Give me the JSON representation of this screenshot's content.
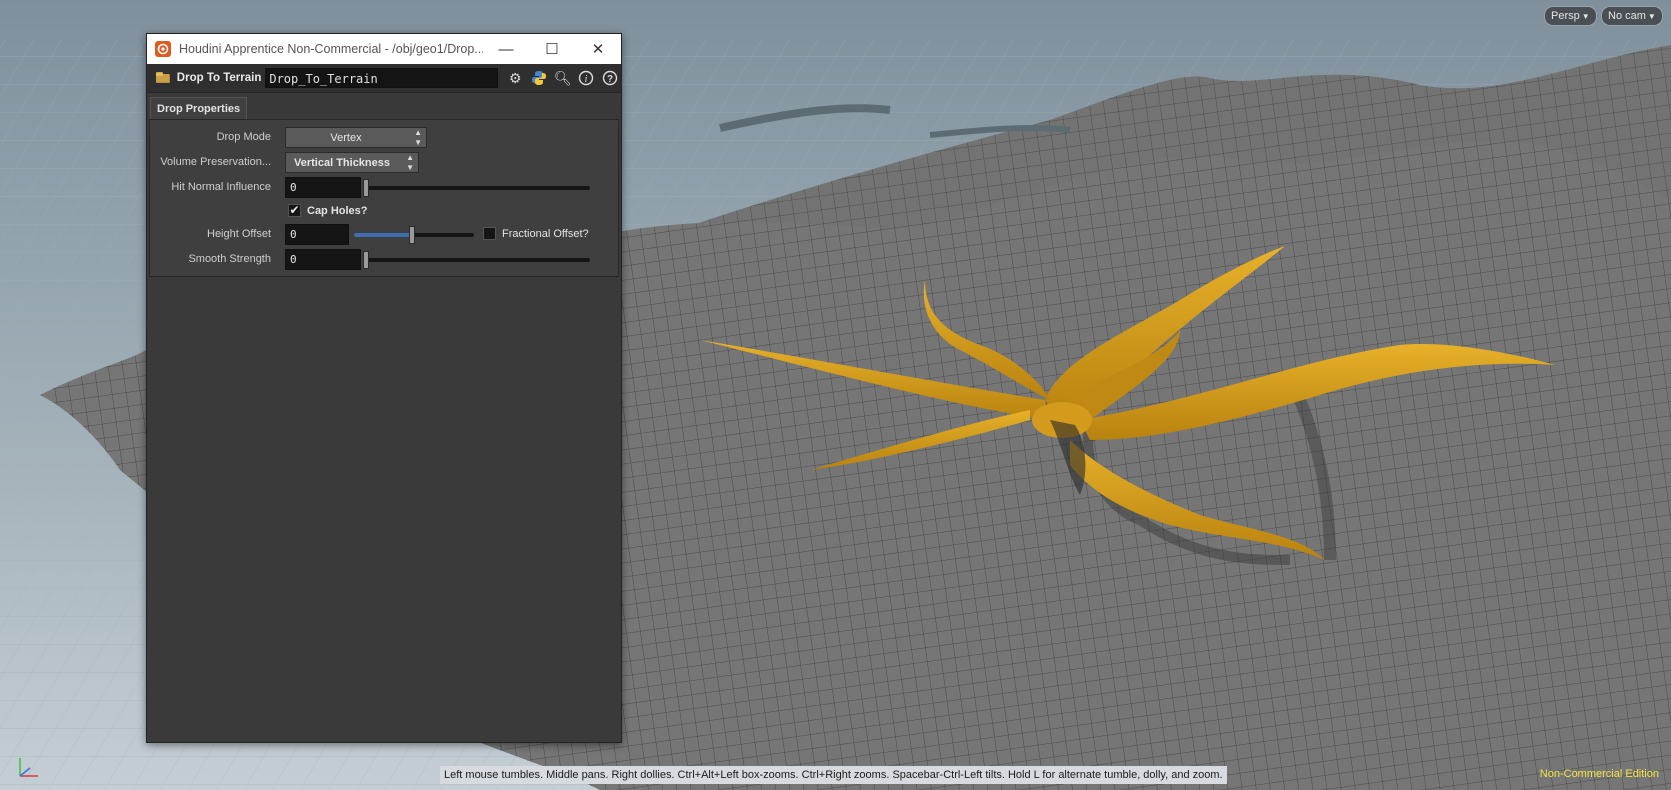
{
  "viewport": {
    "persp_label": "Persp",
    "camera_label": "No cam",
    "status_message": "Left mouse tumbles. Middle pans. Right dollies. Ctrl+Alt+Left box-zooms. Ctrl+Right zooms. Spacebar-Ctrl-Left tilts. Hold L for alternate tumble, dolly, and zoom.",
    "edition": "Non-Commercial Edition",
    "colors": {
      "terrain": "#6e6e6e",
      "object": "#d8a020",
      "sky": "#8fa0ab",
      "edition_text": "#f5e642"
    }
  },
  "dialog": {
    "title": "Houdini Apprentice Non-Commercial - /obj/geo1/Drop...",
    "node_type": "Drop To Terrain",
    "node_name": "Drop_To_Terrain",
    "tab": "Drop Properties",
    "params": {
      "drop_mode": {
        "label": "Drop Mode",
        "value": "Vertex"
      },
      "volume_preservation": {
        "label": "Volume Preservation...",
        "value": "Vertical Thickness"
      },
      "hit_normal_influence": {
        "label": "Hit Normal Influence",
        "value": "0",
        "level": 0
      },
      "cap_holes": {
        "label": "Cap Holes?",
        "checked": true
      },
      "height_offset": {
        "label": "Height Offset",
        "value": "0",
        "level": 0.5
      },
      "fractional_offset": {
        "label": "Fractional Offset?",
        "checked": false
      },
      "smooth_strength": {
        "label": "Smooth Strength",
        "value": "0",
        "level": 0
      }
    }
  }
}
